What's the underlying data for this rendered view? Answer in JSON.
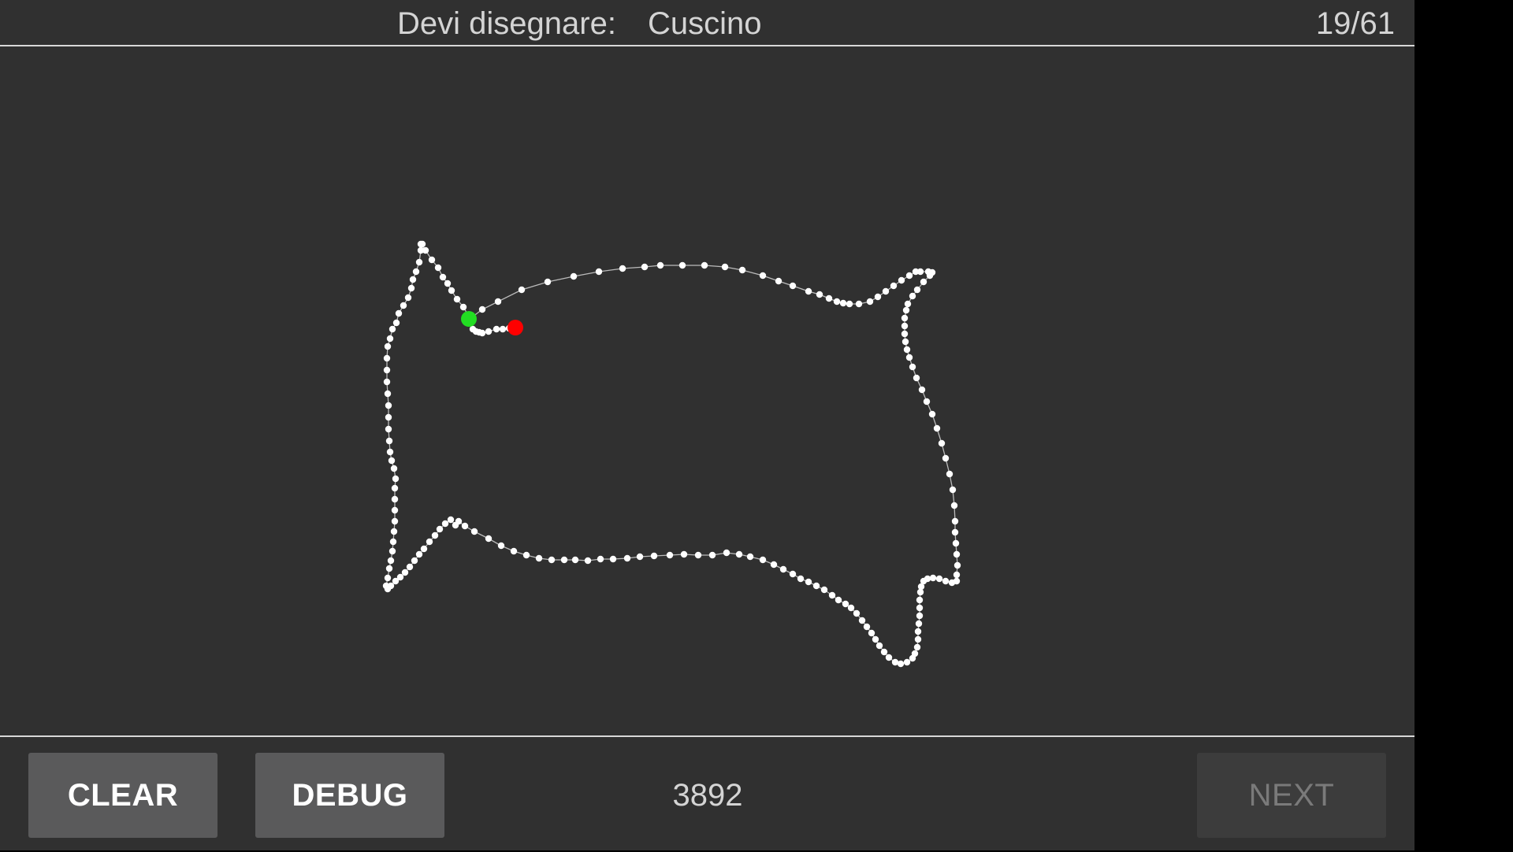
{
  "header": {
    "prompt_label": "Devi disegnare:",
    "prompt_word": "Cuscino",
    "counter": "19/61"
  },
  "footer": {
    "clear_label": "CLEAR",
    "debug_label": "DEBUG",
    "score": "3892",
    "next_label": "NEXT"
  },
  "colors": {
    "background": "#303030",
    "stroke_point": "#ffffff",
    "stroke_line": "#bbbbbb",
    "start_marker": "#22dd22",
    "end_marker": "#ff0000"
  }
}
